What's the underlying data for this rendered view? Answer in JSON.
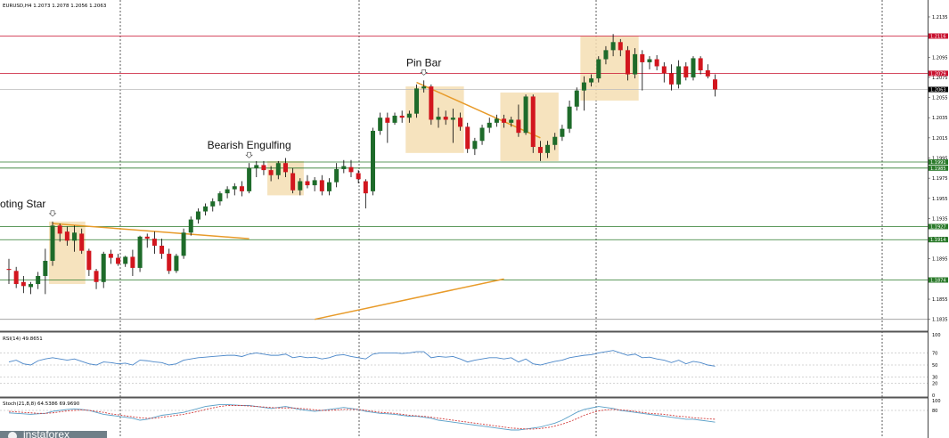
{
  "chart_data": {
    "type": "candlestick",
    "symbol_header": "EURUSD,H4  1.2073 1.2078 1.2056 1.2063",
    "price_axis": {
      "ylim": [
        1.1825,
        1.215
      ],
      "tick_labels": [
        "1.2135",
        "1.2115",
        "1.2095",
        "1.2075",
        "1.2055",
        "1.2035",
        "1.2015",
        "1.1995",
        "1.1975",
        "1.1955",
        "1.1935",
        "1.1915",
        "1.1895",
        "1.1875",
        "1.1855",
        "1.1835"
      ],
      "tick_values": [
        1.2135,
        1.2115,
        1.2095,
        1.2075,
        1.2055,
        1.2035,
        1.2015,
        1.1995,
        1.1975,
        1.1955,
        1.1935,
        1.1915,
        1.1895,
        1.1875,
        1.1855,
        1.1835
      ]
    },
    "candles": [
      {
        "o": 1.1885,
        "h": 1.1895,
        "l": 1.187,
        "c": 1.1884
      },
      {
        "o": 1.1883,
        "h": 1.1887,
        "l": 1.1866,
        "c": 1.187
      },
      {
        "o": 1.1872,
        "h": 1.1878,
        "l": 1.1861,
        "c": 1.1868
      },
      {
        "o": 1.1867,
        "h": 1.1872,
        "l": 1.186,
        "c": 1.187
      },
      {
        "o": 1.187,
        "h": 1.1882,
        "l": 1.1865,
        "c": 1.1878
      },
      {
        "o": 1.1878,
        "h": 1.1905,
        "l": 1.186,
        "c": 1.1893
      },
      {
        "o": 1.1893,
        "h": 1.1932,
        "l": 1.1888,
        "c": 1.1928
      },
      {
        "o": 1.1928,
        "h": 1.193,
        "l": 1.1912,
        "c": 1.192
      },
      {
        "o": 1.1922,
        "h": 1.1927,
        "l": 1.1908,
        "c": 1.1913
      },
      {
        "o": 1.1913,
        "h": 1.1928,
        "l": 1.1902,
        "c": 1.1921
      },
      {
        "o": 1.192,
        "h": 1.1925,
        "l": 1.19,
        "c": 1.1903
      },
      {
        "o": 1.1903,
        "h": 1.1905,
        "l": 1.1878,
        "c": 1.1884
      },
      {
        "o": 1.1883,
        "h": 1.1885,
        "l": 1.1865,
        "c": 1.1872
      },
      {
        "o": 1.1872,
        "h": 1.1902,
        "l": 1.1866,
        "c": 1.19
      },
      {
        "o": 1.19,
        "h": 1.1904,
        "l": 1.189,
        "c": 1.1896
      },
      {
        "o": 1.1896,
        "h": 1.19,
        "l": 1.1888,
        "c": 1.189
      },
      {
        "o": 1.189,
        "h": 1.1898,
        "l": 1.1887,
        "c": 1.1897
      },
      {
        "o": 1.1897,
        "h": 1.1904,
        "l": 1.1878,
        "c": 1.1886
      },
      {
        "o": 1.1886,
        "h": 1.1918,
        "l": 1.1882,
        "c": 1.1917
      },
      {
        "o": 1.1917,
        "h": 1.192,
        "l": 1.1906,
        "c": 1.1915
      },
      {
        "o": 1.1915,
        "h": 1.1922,
        "l": 1.19,
        "c": 1.1908
      },
      {
        "o": 1.1908,
        "h": 1.1915,
        "l": 1.1895,
        "c": 1.19
      },
      {
        "o": 1.19,
        "h": 1.1905,
        "l": 1.188,
        "c": 1.1883
      },
      {
        "o": 1.1883,
        "h": 1.19,
        "l": 1.1881,
        "c": 1.1898
      },
      {
        "o": 1.1898,
        "h": 1.1925,
        "l": 1.1895,
        "c": 1.1921
      },
      {
        "o": 1.1921,
        "h": 1.1937,
        "l": 1.1918,
        "c": 1.1934
      },
      {
        "o": 1.1934,
        "h": 1.1945,
        "l": 1.193,
        "c": 1.1942
      },
      {
        "o": 1.1942,
        "h": 1.195,
        "l": 1.1938,
        "c": 1.1947
      },
      {
        "o": 1.1947,
        "h": 1.1955,
        "l": 1.1942,
        "c": 1.1952
      },
      {
        "o": 1.1952,
        "h": 1.1962,
        "l": 1.1948,
        "c": 1.196
      },
      {
        "o": 1.196,
        "h": 1.1967,
        "l": 1.1955,
        "c": 1.1964
      },
      {
        "o": 1.1964,
        "h": 1.197,
        "l": 1.1958,
        "c": 1.1967
      },
      {
        "o": 1.1967,
        "h": 1.1972,
        "l": 1.1957,
        "c": 1.1962
      },
      {
        "o": 1.1962,
        "h": 1.199,
        "l": 1.196,
        "c": 1.1985
      },
      {
        "o": 1.1985,
        "h": 1.1992,
        "l": 1.1976,
        "c": 1.1988
      },
      {
        "o": 1.1988,
        "h": 1.1992,
        "l": 1.1978,
        "c": 1.1983
      },
      {
        "o": 1.1983,
        "h": 1.1987,
        "l": 1.1972,
        "c": 1.1978
      },
      {
        "o": 1.1978,
        "h": 1.1992,
        "l": 1.1974,
        "c": 1.199
      },
      {
        "o": 1.199,
        "h": 1.1995,
        "l": 1.1976,
        "c": 1.1981
      },
      {
        "o": 1.198,
        "h": 1.1985,
        "l": 1.196,
        "c": 1.1963
      },
      {
        "o": 1.1963,
        "h": 1.1975,
        "l": 1.1958,
        "c": 1.1972
      },
      {
        "o": 1.1972,
        "h": 1.1978,
        "l": 1.1965,
        "c": 1.1968
      },
      {
        "o": 1.1968,
        "h": 1.1976,
        "l": 1.1962,
        "c": 1.1973
      },
      {
        "o": 1.1973,
        "h": 1.1978,
        "l": 1.1958,
        "c": 1.1962
      },
      {
        "o": 1.1962,
        "h": 1.1975,
        "l": 1.1958,
        "c": 1.1971
      },
      {
        "o": 1.1971,
        "h": 1.199,
        "l": 1.1966,
        "c": 1.1984
      },
      {
        "o": 1.1984,
        "h": 1.1993,
        "l": 1.198,
        "c": 1.1987
      },
      {
        "o": 1.1986,
        "h": 1.1993,
        "l": 1.1976,
        "c": 1.1981
      },
      {
        "o": 1.198,
        "h": 1.1983,
        "l": 1.197,
        "c": 1.1974
      },
      {
        "o": 1.1972,
        "h": 1.1974,
        "l": 1.1945,
        "c": 1.196
      },
      {
        "o": 1.1962,
        "h": 1.2025,
        "l": 1.1958,
        "c": 1.2022
      },
      {
        "o": 1.2022,
        "h": 1.204,
        "l": 1.2018,
        "c": 1.2035
      },
      {
        "o": 1.2035,
        "h": 1.204,
        "l": 1.201,
        "c": 1.203
      },
      {
        "o": 1.203,
        "h": 1.204,
        "l": 1.2028,
        "c": 1.2037
      },
      {
        "o": 1.2037,
        "h": 1.2042,
        "l": 1.203,
        "c": 1.2035
      },
      {
        "o": 1.2035,
        "h": 1.2042,
        "l": 1.203,
        "c": 1.2039
      },
      {
        "o": 1.2039,
        "h": 1.2068,
        "l": 1.2035,
        "c": 1.2064
      },
      {
        "o": 1.2064,
        "h": 1.2072,
        "l": 1.206,
        "c": 1.2066
      },
      {
        "o": 1.2066,
        "h": 1.2068,
        "l": 1.2028,
        "c": 1.2033
      },
      {
        "o": 1.2033,
        "h": 1.2045,
        "l": 1.2025,
        "c": 1.2036
      },
      {
        "o": 1.2036,
        "h": 1.2042,
        "l": 1.2028,
        "c": 1.2033
      },
      {
        "o": 1.2033,
        "h": 1.2044,
        "l": 1.201,
        "c": 1.2035
      },
      {
        "o": 1.2035,
        "h": 1.204,
        "l": 1.2022,
        "c": 1.2026
      },
      {
        "o": 1.2026,
        "h": 1.203,
        "l": 1.2,
        "c": 1.2004
      },
      {
        "o": 1.2004,
        "h": 1.2015,
        "l": 1.1998,
        "c": 1.2012
      },
      {
        "o": 1.2012,
        "h": 1.2028,
        "l": 1.2008,
        "c": 1.2025
      },
      {
        "o": 1.2025,
        "h": 1.2035,
        "l": 1.202,
        "c": 1.203
      },
      {
        "o": 1.203,
        "h": 1.2038,
        "l": 1.2026,
        "c": 1.2034
      },
      {
        "o": 1.2034,
        "h": 1.2038,
        "l": 1.2025,
        "c": 1.203
      },
      {
        "o": 1.203,
        "h": 1.2036,
        "l": 1.2026,
        "c": 1.2033
      },
      {
        "o": 1.2033,
        "h": 1.2048,
        "l": 1.2016,
        "c": 1.202
      },
      {
        "o": 1.202,
        "h": 1.2058,
        "l": 1.2018,
        "c": 1.2056
      },
      {
        "o": 1.2056,
        "h": 1.2058,
        "l": 1.2,
        "c": 1.2006
      },
      {
        "o": 1.2006,
        "h": 1.2012,
        "l": 1.1992,
        "c": 1.2
      },
      {
        "o": 1.2,
        "h": 1.2012,
        "l": 1.1995,
        "c": 1.2008
      },
      {
        "o": 1.2008,
        "h": 1.202,
        "l": 1.2003,
        "c": 1.2016
      },
      {
        "o": 1.2016,
        "h": 1.2028,
        "l": 1.2012,
        "c": 1.2024
      },
      {
        "o": 1.2024,
        "h": 1.2052,
        "l": 1.202,
        "c": 1.2046
      },
      {
        "o": 1.2046,
        "h": 1.2065,
        "l": 1.2042,
        "c": 1.2062
      },
      {
        "o": 1.2062,
        "h": 1.2076,
        "l": 1.2042,
        "c": 1.207
      },
      {
        "o": 1.207,
        "h": 1.2078,
        "l": 1.2066,
        "c": 1.2074
      },
      {
        "o": 1.2074,
        "h": 1.2096,
        "l": 1.207,
        "c": 1.2093
      },
      {
        "o": 1.2093,
        "h": 1.2106,
        "l": 1.2088,
        "c": 1.2102
      },
      {
        "o": 1.2102,
        "h": 1.2118,
        "l": 1.2096,
        "c": 1.211
      },
      {
        "o": 1.211,
        "h": 1.2113,
        "l": 1.2096,
        "c": 1.2102
      },
      {
        "o": 1.2102,
        "h": 1.2106,
        "l": 1.2072,
        "c": 1.2078
      },
      {
        "o": 1.2078,
        "h": 1.2104,
        "l": 1.2074,
        "c": 1.2098
      },
      {
        "o": 1.2098,
        "h": 1.2102,
        "l": 1.2062,
        "c": 1.209
      },
      {
        "o": 1.209,
        "h": 1.2096,
        "l": 1.2083,
        "c": 1.2093
      },
      {
        "o": 1.2093,
        "h": 1.2097,
        "l": 1.2082,
        "c": 1.2086
      },
      {
        "o": 1.2086,
        "h": 1.209,
        "l": 1.207,
        "c": 1.2079
      },
      {
        "o": 1.2079,
        "h": 1.2088,
        "l": 1.2062,
        "c": 1.2068
      },
      {
        "o": 1.2068,
        "h": 1.2092,
        "l": 1.2064,
        "c": 1.2086
      },
      {
        "o": 1.2086,
        "h": 1.209,
        "l": 1.2072,
        "c": 1.2075
      },
      {
        "o": 1.2075,
        "h": 1.2096,
        "l": 1.2072,
        "c": 1.2094
      },
      {
        "o": 1.2094,
        "h": 1.2096,
        "l": 1.2078,
        "c": 1.2082
      },
      {
        "o": 1.2082,
        "h": 1.2088,
        "l": 1.2074,
        "c": 1.2076
      },
      {
        "o": 1.2073,
        "h": 1.2078,
        "l": 1.2056,
        "c": 1.2063
      }
    ],
    "horizontal_levels": [
      {
        "price": 1.2116,
        "label": "1.2116",
        "color": "#c8102e"
      },
      {
        "price": 1.2079,
        "label": "1.2079",
        "color": "#c8102e"
      },
      {
        "price": 1.1991,
        "label": "1.1991",
        "color": "#2a7a2a"
      },
      {
        "price": 1.1985,
        "label": "1.1985",
        "color": "#2a7a2a"
      },
      {
        "price": 1.1927,
        "label": "1.1927",
        "color": "#2a7a2a"
      },
      {
        "price": 1.1914,
        "label": "1.1914",
        "color": "#2a7a2a"
      },
      {
        "price": 1.1874,
        "label": "1.1874",
        "color": "#2a7a2a"
      }
    ],
    "current_price": {
      "price": 1.2063,
      "label": "1.2063"
    },
    "bottom_level": {
      "price": 1.1835
    },
    "annotations": [
      {
        "text": "oting Star",
        "candle": 6
      },
      {
        "text": "Bearish Engulfing",
        "candle": 33
      },
      {
        "text": "Pin Bar",
        "candle": 57
      }
    ],
    "highlight_boxes": [
      {
        "from": 6,
        "to": 10,
        "top": 1.1932,
        "bottom": 1.187
      },
      {
        "from": 36,
        "to": 40,
        "top": 1.1992,
        "bottom": 1.1958
      },
      {
        "from": 55,
        "to": 62,
        "top": 1.2066,
        "bottom": 1.2
      },
      {
        "from": 68,
        "to": 75,
        "top": 1.206,
        "bottom": 1.1992
      },
      {
        "from": 79,
        "to": 86,
        "top": 1.2116,
        "bottom": 1.2052
      }
    ],
    "trendlines": [
      {
        "from": {
          "candle": 6,
          "price": 1.193
        },
        "to": {
          "candle": 33,
          "price": 1.1915
        }
      },
      {
        "from": {
          "candle": 42,
          "price": 1.1835
        },
        "to": {
          "candle": 68,
          "price": 1.1875
        }
      },
      {
        "from": {
          "candle": 56,
          "price": 1.207
        },
        "to": {
          "candle": 73,
          "price": 1.2015
        }
      }
    ],
    "colors": {
      "bull": "#1e6b2a",
      "bear": "#d2161e",
      "trend": "#e89b2a",
      "box": "#f5deb3"
    },
    "rsi": {
      "header": "RSI(14) 49.8651",
      "ylim": [
        0,
        100
      ],
      "tick_labels": [
        "100",
        "70",
        "50",
        "30",
        "20",
        "0"
      ],
      "tick_values": [
        100,
        70,
        50,
        30,
        20,
        0
      ],
      "values": [
        55,
        58,
        52,
        50,
        57,
        60,
        62,
        60,
        58,
        60,
        56,
        52,
        50,
        55,
        54,
        52,
        53,
        50,
        58,
        57,
        55,
        54,
        50,
        52,
        58,
        60,
        62,
        63,
        64,
        65,
        66,
        66,
        64,
        68,
        70,
        68,
        66,
        66,
        68,
        62,
        64,
        62,
        63,
        60,
        62,
        66,
        67,
        64,
        62,
        60,
        68,
        70,
        70,
        70,
        69,
        70,
        72,
        72,
        62,
        64,
        63,
        64,
        60,
        55,
        58,
        60,
        62,
        62,
        60,
        62,
        55,
        60,
        52,
        50,
        53,
        56,
        58,
        62,
        64,
        66,
        67,
        70,
        72,
        74,
        70,
        66,
        68,
        62,
        63,
        60,
        58,
        54,
        58,
        52,
        56,
        54,
        50,
        48
      ]
    },
    "stoch": {
      "header": "Stoch(21,8,8) 64.5386 69.9690",
      "ylim": [
        0,
        100
      ],
      "tick_labels": [
        "100",
        "80",
        "20",
        "0"
      ],
      "tick_values": [
        100,
        80,
        20,
        0
      ],
      "main": [
        75,
        74,
        73,
        72,
        73,
        74,
        78,
        80,
        82,
        83,
        82,
        80,
        76,
        72,
        70,
        68,
        66,
        64,
        60,
        62,
        66,
        70,
        72,
        74,
        76,
        80,
        84,
        88,
        90,
        92,
        92,
        91,
        90,
        90,
        88,
        86,
        84,
        86,
        88,
        85,
        82,
        80,
        78,
        80,
        82,
        84,
        86,
        84,
        82,
        78,
        76,
        74,
        73,
        72,
        70,
        68,
        68,
        66,
        64,
        60,
        58,
        56,
        54,
        52,
        50,
        48,
        46,
        44,
        42,
        40,
        40,
        42,
        44,
        46,
        50,
        54,
        60,
        68,
        76,
        82,
        85,
        88,
        86,
        84,
        80,
        78,
        76,
        74,
        72,
        70,
        68,
        66,
        64,
        62,
        62,
        60,
        58,
        56
      ],
      "signal": [
        78,
        77,
        76,
        75,
        74,
        74,
        75,
        77,
        79,
        80,
        81,
        80,
        78,
        76,
        73,
        71,
        69,
        67,
        65,
        64,
        64,
        66,
        68,
        70,
        72,
        75,
        78,
        82,
        85,
        88,
        90,
        90,
        90,
        89,
        88,
        87,
        86,
        85,
        85,
        85,
        84,
        83,
        81,
        80,
        80,
        81,
        82,
        82,
        82,
        80,
        78,
        76,
        75,
        74,
        72,
        70,
        69,
        68,
        66,
        64,
        62,
        60,
        58,
        56,
        54,
        52,
        50,
        48,
        46,
        44,
        43,
        42,
        42,
        43,
        45,
        48,
        52,
        57,
        63,
        70,
        75,
        79,
        81,
        82,
        81,
        80,
        78,
        76,
        74,
        73,
        72,
        70,
        68,
        67,
        65,
        64,
        63,
        62
      ]
    }
  },
  "watermark": "instaforex"
}
